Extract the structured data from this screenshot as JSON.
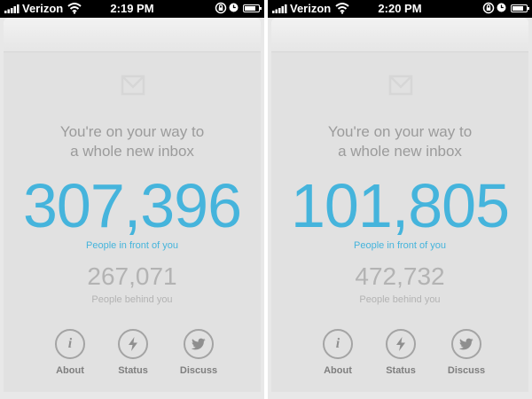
{
  "colors": {
    "accent": "#45b4dc",
    "muted_text": "#9b9b9b",
    "card_background": "#e1e1e1",
    "icon_outline": "#a4a4a4"
  },
  "screens": [
    {
      "statusbar": {
        "carrier": "Verizon",
        "time": "2:19 PM",
        "icons": [
          "signal-bars-icon",
          "wifi-icon",
          "rotation-lock-icon",
          "alarm-clock-icon",
          "battery-icon"
        ],
        "battery_level": 0.75
      },
      "mailbox": {
        "icon": "mailbox-tray-icon",
        "tagline_line1": "You're on your way to",
        "tagline_line2": "a whole new inbox",
        "people_in_front": "307,396",
        "people_in_front_label": "People in front of you",
        "people_behind": "267,071",
        "people_behind_label": "People behind you"
      },
      "actions": [
        {
          "label": "About",
          "icon": "info-icon"
        },
        {
          "label": "Status",
          "icon": "lightning-bolt-icon"
        },
        {
          "label": "Discuss",
          "icon": "twitter-bird-icon"
        }
      ]
    },
    {
      "statusbar": {
        "carrier": "Verizon",
        "time": "2:20 PM",
        "icons": [
          "signal-bars-icon",
          "wifi-icon",
          "rotation-lock-icon",
          "alarm-clock-icon",
          "battery-icon"
        ],
        "battery_level": 0.75
      },
      "mailbox": {
        "icon": "mailbox-tray-icon",
        "tagline_line1": "You're on your way to",
        "tagline_line2": "a whole new inbox",
        "people_in_front": "101,805",
        "people_in_front_label": "People in front of you",
        "people_behind": "472,732",
        "people_behind_label": "People behind you"
      },
      "actions": [
        {
          "label": "About",
          "icon": "info-icon"
        },
        {
          "label": "Status",
          "icon": "lightning-bolt-icon"
        },
        {
          "label": "Discuss",
          "icon": "twitter-bird-icon"
        }
      ]
    }
  ]
}
